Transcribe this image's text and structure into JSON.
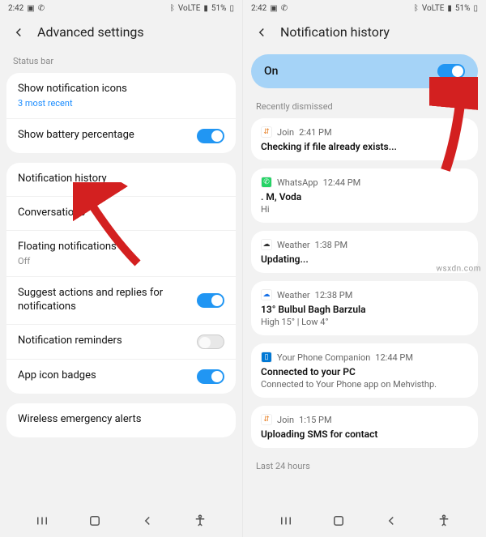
{
  "status": {
    "time": "2:42",
    "battery": "51%",
    "net": "VoLTE"
  },
  "left": {
    "title": "Advanced settings",
    "section1": "Status bar",
    "rows": {
      "show_notif_icons": "Show notification icons",
      "show_notif_icons_sub": "3 most recent",
      "show_battery": "Show battery percentage",
      "notif_history": "Notification history",
      "conversations": "Conversations",
      "floating": "Floating notifications",
      "floating_sub": "Off",
      "suggest": "Suggest actions and replies for notifications",
      "reminders": "Notification reminders",
      "badges": "App icon badges",
      "wireless": "Wireless emergency alerts"
    }
  },
  "right": {
    "title": "Notification history",
    "on_label": "On",
    "recently": "Recently dismissed",
    "last24": "Last 24 hours",
    "items": [
      {
        "app": "Join",
        "time": "2:41 PM",
        "title": "Checking if file already exists...",
        "body": "",
        "icon_bg": "#fff",
        "icon_color": "#e67e22",
        "glyph": "⇵"
      },
      {
        "app": "WhatsApp",
        "time": "12:44 PM",
        "title": ". M, Voda",
        "body": "Hi",
        "icon_bg": "#25d366",
        "icon_color": "#fff",
        "glyph": "✆"
      },
      {
        "app": "Weather",
        "time": "1:38 PM",
        "title": "Updating...",
        "body": "",
        "icon_bg": "#fff",
        "icon_color": "#333",
        "glyph": "☁"
      },
      {
        "app": "Weather",
        "time": "12:38 PM",
        "title": "13° Bulbul Bagh Barzula",
        "body": "High 15° | Low 4°",
        "icon_bg": "#fff",
        "icon_color": "#1a73e8",
        "glyph": "☁"
      },
      {
        "app": "Your Phone Companion",
        "time": "12:44 PM",
        "title": "Connected to your PC",
        "body": "Connected to Your Phone app on Mehvisthp.",
        "icon_bg": "#0078d4",
        "icon_color": "#fff",
        "glyph": "▯"
      },
      {
        "app": "Join",
        "time": "1:15 PM",
        "title": "Uploading SMS for contact",
        "body": "",
        "icon_bg": "#fff",
        "icon_color": "#e67e22",
        "glyph": "⇵"
      }
    ]
  },
  "watermark": "wsxdn.com"
}
